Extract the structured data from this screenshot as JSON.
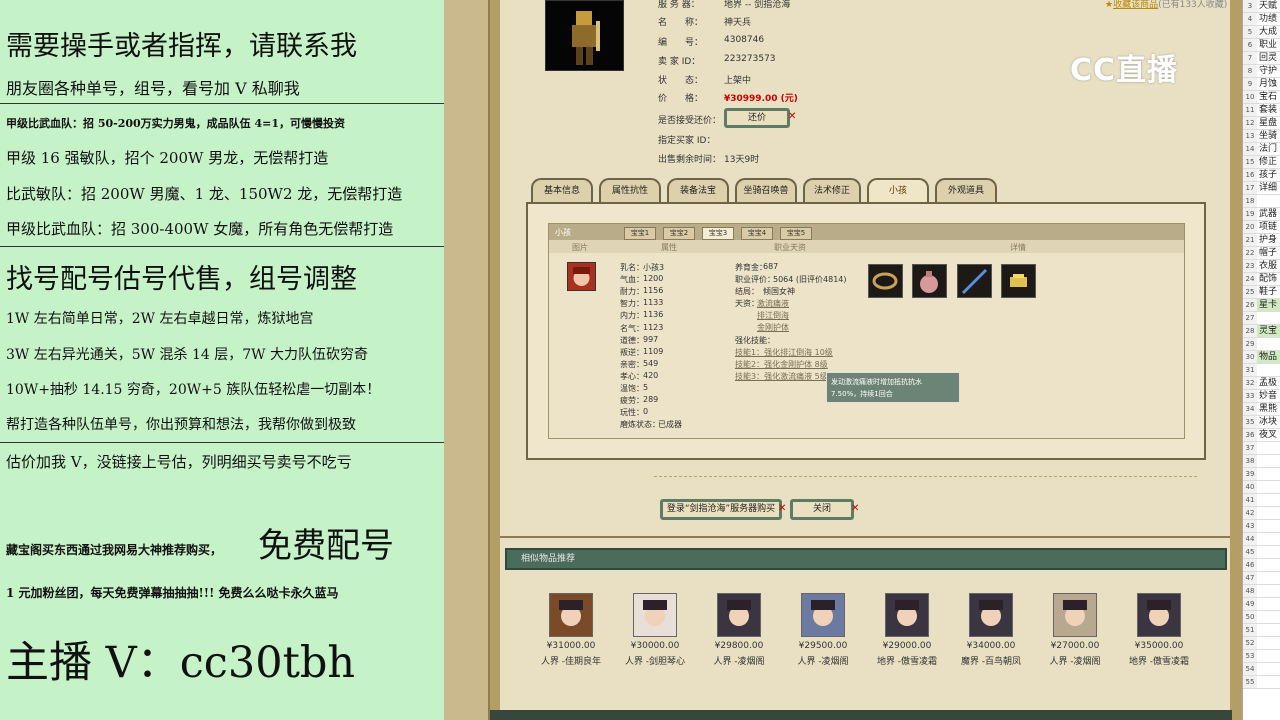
{
  "left_overlay": {
    "lines": [
      "需要操手或者指挥，请联系我",
      "朋友圈各种单号，组号，看号加 V 私聊我",
      "甲级比武血队：招 50-200万实力男鬼，成品队伍 4=1，可慢慢投资",
      "甲级 16 强敏队，招个 200W 男龙，无偿帮打造",
      "比武敏队：招 200W 男魔、1 龙、150W2 龙，无偿帮打造",
      "甲级比武血队：招 300-400W 女魔，所有角色无偿帮打造",
      "找号配号估号代售，组号调整",
      "1W 左右简单日常，2W 左右卓越日常，炼狱地宫",
      "3W 左右异光通关，5W 混杀 14 层，7W 大力队伍砍穷奇",
      "10W+抽秒 14.15 穷奇，20W+5 族队伍轻松虐一切副本！",
      "帮打造各种队伍单号，你出预算和想法，我帮你做到极致",
      "估价加我 V，没链接上号估，列明细买号卖号不吃亏",
      "藏宝阁买东西通过我网易大神推荐购买，",
      "免费配号",
      "1 元加粉丝团，每天免费弹幕抽抽抽!!! 免费么么哒卡永久蓝马",
      "主播 V：cc30tbh"
    ]
  },
  "watermark": "CC直播",
  "detail": {
    "server_label": "服 务 器：",
    "server_value": "地界 -- 剑指沧海",
    "name_label": "名　　称：",
    "name_value": "神天兵",
    "id_label": "编　　号：",
    "id_value": "4308746",
    "seller_label": "卖 家 ID：",
    "seller_value": "223273573",
    "status_label": "状　　态：",
    "status_value": "上架中",
    "price_label": "价　　格：",
    "price_value": "¥30999.00 (元)",
    "bargain_label": "是否接受还价：",
    "bargain_button": "还价",
    "buyer_label": "指定买家 ID：",
    "remain_label": "出售剩余时间：",
    "remain_value": "13天9时",
    "favorite": "收藏该商品",
    "favorite_count": "(已有133人收藏)"
  },
  "tabs": [
    "基本信息",
    "属性抗性",
    "装备法宝",
    "坐骑召唤兽",
    "法术修正",
    "小孩",
    "外观道具"
  ],
  "active_tab": "小孩",
  "child_panel": {
    "title": "小孩",
    "subtabs": [
      "宝宝1",
      "宝宝2",
      "宝宝3",
      "宝宝4",
      "宝宝5"
    ],
    "active_subtab": "宝宝3",
    "headers": [
      "图片",
      "属性",
      "职业天资",
      "详情"
    ],
    "attrs": [
      {
        "k": "乳名：",
        "v": "小孩3"
      },
      {
        "k": "气血：",
        "v": "1200"
      },
      {
        "k": "耐力：",
        "v": "1156"
      },
      {
        "k": "智力：",
        "v": "1133"
      },
      {
        "k": "内力：",
        "v": "1136"
      },
      {
        "k": "名气：",
        "v": "1123"
      },
      {
        "k": "道德：",
        "v": "997"
      },
      {
        "k": "叛逆：",
        "v": "1109"
      },
      {
        "k": "亲密：",
        "v": "549"
      },
      {
        "k": "孝心：",
        "v": "420"
      },
      {
        "k": "温饱：",
        "v": "5"
      },
      {
        "k": "疲劳：",
        "v": "289"
      },
      {
        "k": "玩性：",
        "v": "0"
      },
      {
        "k": "磨炼状态：",
        "v": "已成器"
      }
    ],
    "prof": [
      {
        "k": "养育金：",
        "v": "687"
      },
      {
        "k": "职业评价：",
        "v": "5064 (旧评价4814)"
      },
      {
        "k": "结局：",
        "v": "倾国女神"
      }
    ],
    "talent_label": "天资：",
    "talents": [
      "激流痛液",
      "排江倒海",
      "金刚护体"
    ],
    "skill_label": "强化技能：",
    "skills": [
      "技能1：强化排江倒海 10级",
      "技能2：强化金刚护体 8级",
      "技能3：强化激流痛液 5级"
    ],
    "tooltip": [
      "发动激流痛液时增加抵抗抗水",
      "7.50%，持续1回合"
    ]
  },
  "buttons": {
    "login": "登录“剑指沧海”服务器购买",
    "close": "关闭"
  },
  "recommend": {
    "title": "相似物品推荐",
    "items": [
      {
        "price": "¥31000.00",
        "name": "人界 -佳期良年"
      },
      {
        "price": "¥30000.00",
        "name": "人界 -剑胆琴心"
      },
      {
        "price": "¥29800.00",
        "name": "人界 -凌烟阁"
      },
      {
        "price": "¥29500.00",
        "name": "人界 -凌烟阁"
      },
      {
        "price": "¥29000.00",
        "name": "地界 -傲雪凌霜"
      },
      {
        "price": "¥34000.00",
        "name": "魔界 -百鸟朝凤"
      },
      {
        "price": "¥27000.00",
        "name": "人界 -凌烟阁"
      },
      {
        "price": "¥35000.00",
        "name": "地界 -傲雪凌霜"
      }
    ]
  },
  "sheet": {
    "rows": [
      {
        "n": "3",
        "t": "天赋"
      },
      {
        "n": "4",
        "t": "功绩"
      },
      {
        "n": "5",
        "t": "大成"
      },
      {
        "n": "6",
        "t": "职业"
      },
      {
        "n": "7",
        "t": "回灵"
      },
      {
        "n": "8",
        "t": "守护"
      },
      {
        "n": "9",
        "t": "月蚀"
      },
      {
        "n": "10",
        "t": "宝石"
      },
      {
        "n": "11",
        "t": "套装"
      },
      {
        "n": "12",
        "t": "星盘"
      },
      {
        "n": "13",
        "t": "坐骑"
      },
      {
        "n": "14",
        "t": "法门"
      },
      {
        "n": "15",
        "t": "修正"
      },
      {
        "n": "16",
        "t": "孩子"
      },
      {
        "n": "17",
        "t": "详细"
      },
      {
        "n": "18",
        "t": ""
      },
      {
        "n": "19",
        "t": "武器"
      },
      {
        "n": "20",
        "t": "项链"
      },
      {
        "n": "21",
        "t": "护身"
      },
      {
        "n": "22",
        "t": "帽子"
      },
      {
        "n": "23",
        "t": "衣服"
      },
      {
        "n": "24",
        "t": "配饰"
      },
      {
        "n": "25",
        "t": "鞋子"
      },
      {
        "n": "26",
        "t": "星卡"
      },
      {
        "n": "27",
        "t": ""
      },
      {
        "n": "28",
        "t": "灵宝"
      },
      {
        "n": "29",
        "t": ""
      },
      {
        "n": "30",
        "t": "物品"
      },
      {
        "n": "31",
        "t": ""
      },
      {
        "n": "32",
        "t": "孟极"
      },
      {
        "n": "33",
        "t": "妙音"
      },
      {
        "n": "34",
        "t": "黑熊"
      },
      {
        "n": "35",
        "t": "冰块"
      },
      {
        "n": "36",
        "t": "夜叉"
      },
      {
        "n": "37",
        "t": ""
      },
      {
        "n": "38",
        "t": ""
      },
      {
        "n": "39",
        "t": ""
      },
      {
        "n": "40",
        "t": ""
      },
      {
        "n": "41",
        "t": ""
      },
      {
        "n": "42",
        "t": ""
      },
      {
        "n": "43",
        "t": ""
      },
      {
        "n": "44",
        "t": ""
      },
      {
        "n": "45",
        "t": ""
      },
      {
        "n": "46",
        "t": ""
      },
      {
        "n": "47",
        "t": ""
      },
      {
        "n": "48",
        "t": ""
      },
      {
        "n": "49",
        "t": ""
      },
      {
        "n": "50",
        "t": ""
      },
      {
        "n": "51",
        "t": ""
      },
      {
        "n": "52",
        "t": ""
      },
      {
        "n": "53",
        "t": ""
      },
      {
        "n": "54",
        "t": ""
      },
      {
        "n": "55",
        "t": ""
      }
    ]
  },
  "colors": {
    "overlay_bg": "#c6f2c8",
    "accent_green": "#4b6b5b",
    "price_red": "#cc0000"
  }
}
